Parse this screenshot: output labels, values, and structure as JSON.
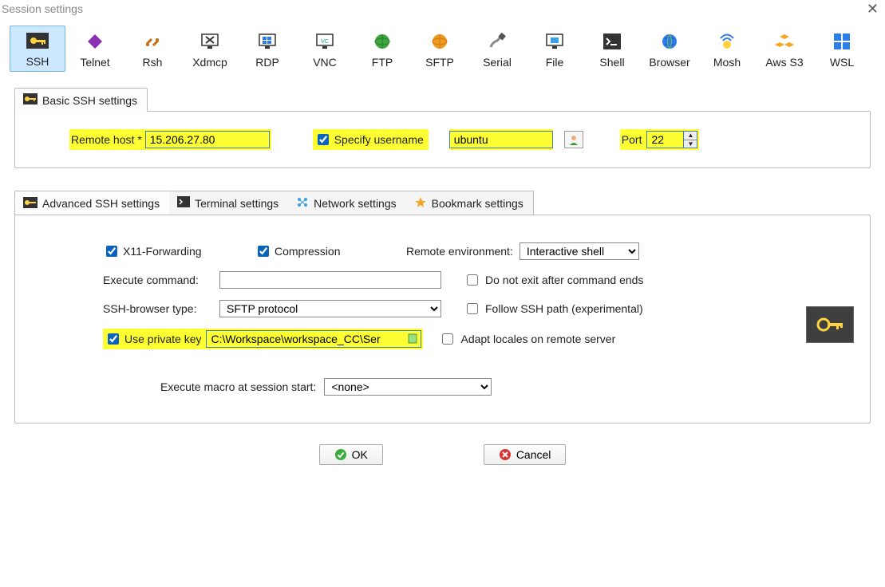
{
  "window": {
    "title": "Session settings"
  },
  "toolbar": {
    "items": [
      {
        "label": "SSH"
      },
      {
        "label": "Telnet"
      },
      {
        "label": "Rsh"
      },
      {
        "label": "Xdmcp"
      },
      {
        "label": "RDP"
      },
      {
        "label": "VNC"
      },
      {
        "label": "FTP"
      },
      {
        "label": "SFTP"
      },
      {
        "label": "Serial"
      },
      {
        "label": "File"
      },
      {
        "label": "Shell"
      },
      {
        "label": "Browser"
      },
      {
        "label": "Mosh"
      },
      {
        "label": "Aws S3"
      },
      {
        "label": "WSL"
      }
    ]
  },
  "tabs_basic": {
    "label": "Basic SSH settings"
  },
  "basic": {
    "remote_host_label": "Remote host *",
    "remote_host": "15.206.27.80",
    "specify_username_label": "Specify username",
    "specify_username_checked": true,
    "username": "ubuntu",
    "port_label": "Port",
    "port": "22"
  },
  "tabs_adv": {
    "items": [
      {
        "label": "Advanced SSH settings"
      },
      {
        "label": "Terminal settings"
      },
      {
        "label": "Network settings"
      },
      {
        "label": "Bookmark settings"
      }
    ]
  },
  "adv": {
    "x11_label": "X11-Forwarding",
    "x11_checked": true,
    "compression_label": "Compression",
    "compression_checked": true,
    "remote_env_label": "Remote environment:",
    "remote_env_value": "Interactive shell",
    "exec_cmd_label": "Execute command:",
    "exec_cmd_value": "",
    "no_exit_label": "Do not exit after command ends",
    "no_exit_checked": false,
    "sshbrowser_label": "SSH-browser type:",
    "sshbrowser_value": "SFTP protocol",
    "follow_path_label": "Follow SSH path (experimental)",
    "follow_path_checked": false,
    "use_pk_label": "Use private key",
    "use_pk_checked": true,
    "pk_path": "C:\\Workspace\\workspace_CC\\Ser",
    "adapt_locales_label": "Adapt locales on remote server",
    "adapt_locales_checked": false,
    "macro_label": "Execute macro at session start:",
    "macro_value": "<none>"
  },
  "buttons": {
    "ok": "OK",
    "cancel": "Cancel"
  }
}
